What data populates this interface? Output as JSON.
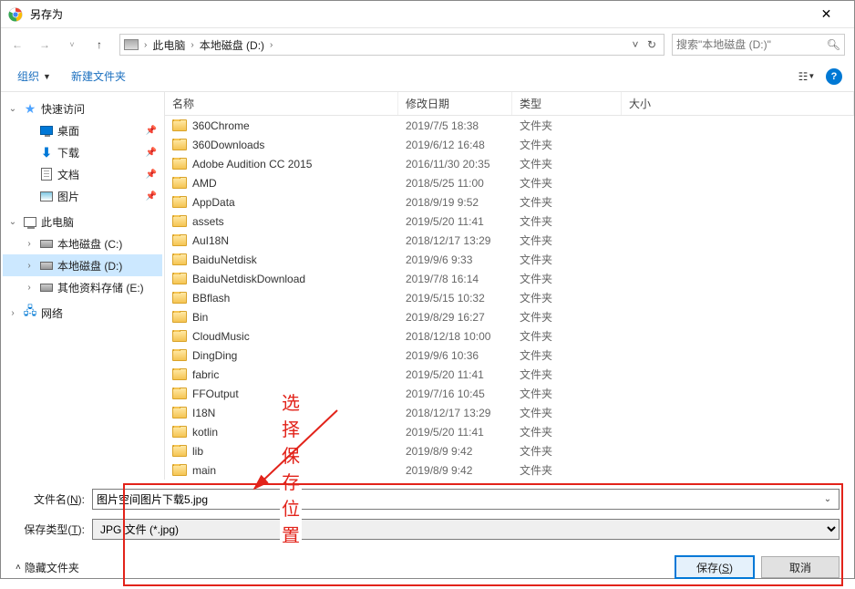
{
  "title": "另存为",
  "breadcrumb": {
    "items": [
      "此电脑",
      "本地磁盘 (D:)"
    ]
  },
  "search": {
    "placeholder": "搜索\"本地磁盘 (D:)\""
  },
  "toolbar": {
    "organize": "组织",
    "newfolder": "新建文件夹"
  },
  "columns": {
    "name": "名称",
    "date": "修改日期",
    "type": "类型",
    "size": "大小"
  },
  "tree": {
    "quick": {
      "label": "快速访问",
      "items": [
        {
          "label": "桌面",
          "icon": "monitor",
          "pin": true
        },
        {
          "label": "下载",
          "icon": "download",
          "pin": true
        },
        {
          "label": "文档",
          "icon": "doc",
          "pin": true
        },
        {
          "label": "图片",
          "icon": "pic",
          "pin": true
        }
      ]
    },
    "pc": {
      "label": "此电脑",
      "items": [
        {
          "label": "本地磁盘 (C:)",
          "icon": "drive"
        },
        {
          "label": "本地磁盘 (D:)",
          "icon": "drive",
          "selected": true
        },
        {
          "label": "其他资料存储 (E:)",
          "icon": "drive"
        }
      ]
    },
    "net": {
      "label": "网络"
    }
  },
  "files": [
    {
      "name": "360Chrome",
      "date": "2019/7/5 18:38",
      "type": "文件夹"
    },
    {
      "name": "360Downloads",
      "date": "2019/6/12 16:48",
      "type": "文件夹"
    },
    {
      "name": "Adobe Audition CC 2015",
      "date": "2016/11/30 20:35",
      "type": "文件夹"
    },
    {
      "name": "AMD",
      "date": "2018/5/25 11:00",
      "type": "文件夹"
    },
    {
      "name": "AppData",
      "date": "2018/9/19 9:52",
      "type": "文件夹"
    },
    {
      "name": "assets",
      "date": "2019/5/20 11:41",
      "type": "文件夹"
    },
    {
      "name": "AuI18N",
      "date": "2018/12/17 13:29",
      "type": "文件夹"
    },
    {
      "name": "BaiduNetdisk",
      "date": "2019/9/6 9:33",
      "type": "文件夹"
    },
    {
      "name": "BaiduNetdiskDownload",
      "date": "2019/7/8 16:14",
      "type": "文件夹"
    },
    {
      "name": "BBflash",
      "date": "2019/5/15 10:32",
      "type": "文件夹"
    },
    {
      "name": "Bin",
      "date": "2019/8/29 16:27",
      "type": "文件夹"
    },
    {
      "name": "CloudMusic",
      "date": "2018/12/18 10:00",
      "type": "文件夹"
    },
    {
      "name": "DingDing",
      "date": "2019/9/6 10:36",
      "type": "文件夹"
    },
    {
      "name": "fabric",
      "date": "2019/5/20 11:41",
      "type": "文件夹"
    },
    {
      "name": "FFOutput",
      "date": "2019/7/16 10:45",
      "type": "文件夹"
    },
    {
      "name": "I18N",
      "date": "2018/12/17 13:29",
      "type": "文件夹"
    },
    {
      "name": "kotlin",
      "date": "2019/5/20 11:41",
      "type": "文件夹"
    },
    {
      "name": "lib",
      "date": "2019/8/9 9:42",
      "type": "文件夹"
    },
    {
      "name": "main",
      "date": "2019/8/9 9:42",
      "type": "文件夹"
    }
  ],
  "form": {
    "filename_label": "文件名(N):",
    "filename_value": "图片空间图片下载5.jpg",
    "filetype_label": "保存类型(T):",
    "filetype_value": "JPG 文件 (*.jpg)"
  },
  "footer": {
    "hide": "隐藏文件夹",
    "save": "保存(S)",
    "cancel": "取消"
  },
  "annotation": {
    "text": "选择保存位置"
  }
}
